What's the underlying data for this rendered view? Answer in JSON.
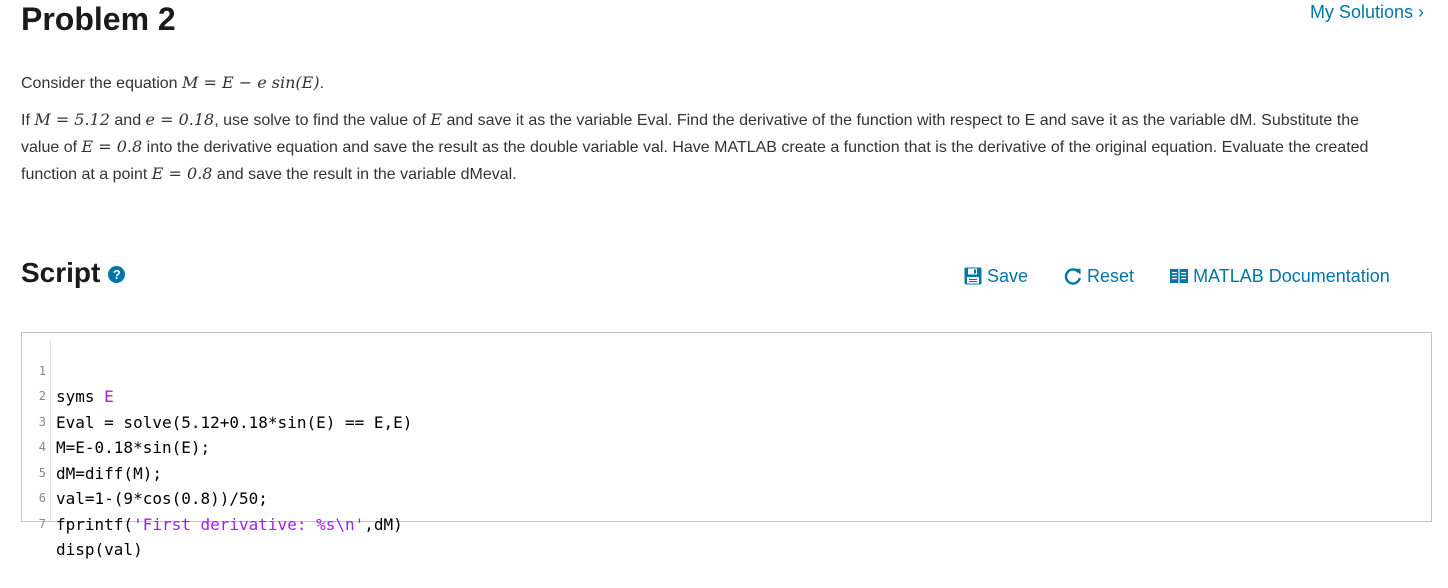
{
  "header": {
    "title": "Problem 2",
    "my_solutions": "My Solutions",
    "chevron_glyph": "›"
  },
  "problem": {
    "p1_text": "Consider the equation",
    "p1_math": "M = E − e sin(E)",
    "p1_end": ".",
    "p2": {
      "t1": "If",
      "m1": "M = 5.12",
      "t2": "and",
      "m2": "e = 0.18",
      "t3": ", use solve to find the value of",
      "m3": "E",
      "t4": "and save it as the variable Eval. Find the derivative of the function with respect to E and save it as the variable dM. Substitute the value of",
      "m4": "E = 0.8",
      "t5": "into the derivative equation and save the result as the double variable val. Have MATLAB create a function that is the derivative of the original equation. Evaluate the created function at a point",
      "m5": "E = 0.8",
      "t6": "and save the result in the variable dMeval."
    }
  },
  "script": {
    "title": "Script",
    "help_glyph": "?",
    "save_label": "Save",
    "reset_label": "Reset",
    "docs_label": "MATLAB Documentation"
  },
  "code_lines": [
    {
      "num": "1",
      "a": "syms ",
      "b": "E",
      "c": ""
    },
    {
      "num": "2",
      "a": "Eval = solve(5.12+0.18*sin(E) == E,E)",
      "b": "",
      "c": ""
    },
    {
      "num": "3",
      "a": "M=E-0.18*sin(E);",
      "b": "",
      "c": ""
    },
    {
      "num": "4",
      "a": "dM=diff(M);",
      "b": "",
      "c": ""
    },
    {
      "num": "5",
      "a": "val=1-(9*cos(0.8))/50;",
      "b": "",
      "c": ""
    },
    {
      "num": "6",
      "a": "fprintf(",
      "b": "'First derivative: %s\\n'",
      "c": ",dM)"
    },
    {
      "num": "7",
      "a": "disp(val)",
      "b": "",
      "c": ""
    }
  ],
  "colors": {
    "link": "#0076a8",
    "string": "#a020f0"
  }
}
